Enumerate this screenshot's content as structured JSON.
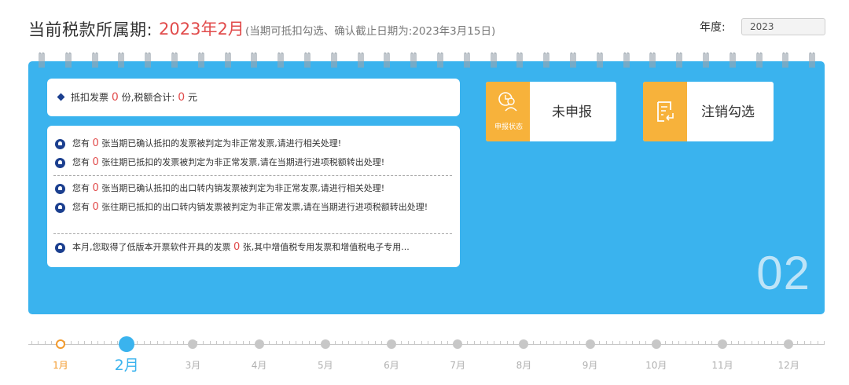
{
  "header": {
    "label": "当前税款所属期:",
    "period": "2023年2月",
    "note": "(当期可抵扣勾选、确认截止日期为:2023年3月15日)",
    "year_label": "年度:",
    "year_value": "2023"
  },
  "summary": {
    "prefix": "抵扣发票",
    "count": "0",
    "mid": "份,税额合计:",
    "amount": "0",
    "suffix": "元"
  },
  "notices": [
    {
      "pre": "您有",
      "num": "0",
      "text": "张当期已确认抵扣的发票被判定为非正常发票,请进行相关处理!"
    },
    {
      "pre": "您有",
      "num": "0",
      "text": "张往期已抵扣的发票被判定为非正常发票,请在当期进行进项税额转出处理!"
    },
    {
      "pre": "您有",
      "num": "0",
      "text": "张当期已确认抵扣的出口转内销发票被判定为非正常发票,请进行相关处理!"
    },
    {
      "pre": "您有",
      "num": "0",
      "text": "张往期已抵扣的出口转内销发票被判定为非正常发票,请在当期进行进项税额转出处理!"
    },
    {
      "pre": "本月,您取得了低版本开票软件开具的发票",
      "num": "0",
      "text": "张,其中增值税专用发票和增值税电子专用..."
    }
  ],
  "tiles": {
    "status": {
      "icon_caption": "申报状态",
      "label": "未申报"
    },
    "cancel": {
      "label": "注销勾选"
    }
  },
  "current_month_display": "02",
  "timeline": {
    "months": [
      "1月",
      "2月",
      "3月",
      "4月",
      "5月",
      "6月",
      "7月",
      "8月",
      "9月",
      "10月",
      "11月",
      "12月"
    ],
    "completed": [
      "1月"
    ],
    "active": "2月"
  },
  "colors": {
    "panel": "#3ab3ee",
    "accent_red": "#e14b4b",
    "tile_icon": "#f7b23b",
    "done_orange": "#f39a2c",
    "icon_navy": "#1b3f8f"
  },
  "icons": {
    "status_tile": "user-clock-icon",
    "cancel_tile": "document-return-icon",
    "notice": "bell-icon",
    "summary_bullet": "diamond-icon"
  }
}
